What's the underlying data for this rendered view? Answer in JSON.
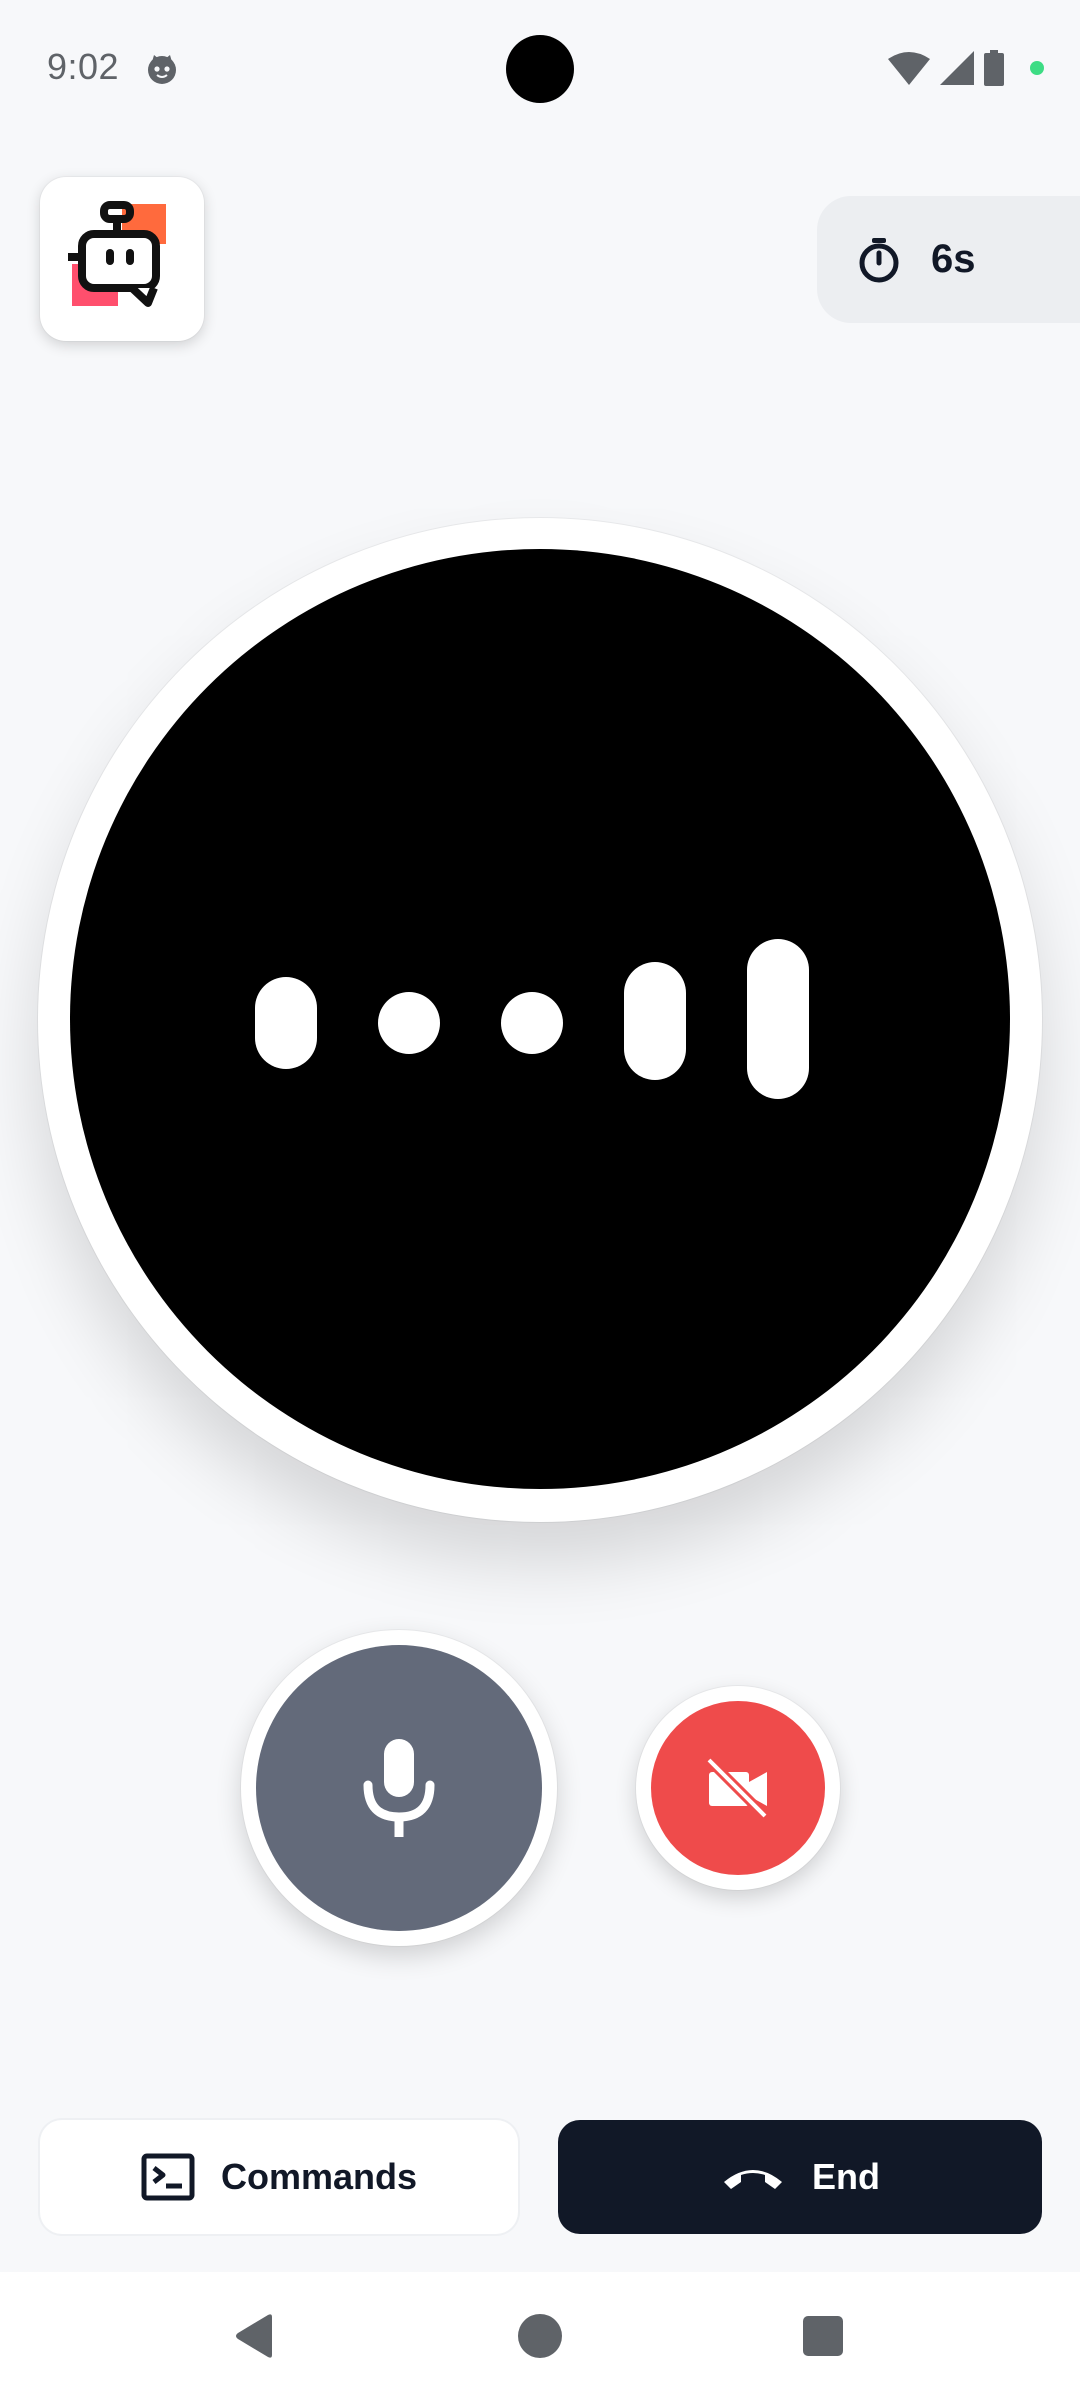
{
  "status_bar": {
    "time": "9:02",
    "app_icon": "cat-notification-icon",
    "icons": [
      "wifi-icon",
      "cellular-signal-icon",
      "battery-icon",
      "privacy-indicator-dot"
    ],
    "indicator_color": "#3ddc84"
  },
  "header": {
    "logo_icon": "robot-logo-icon",
    "timer": {
      "icon": "stopwatch-icon",
      "label": "6s"
    }
  },
  "audio_visualizer": {
    "icon": "audio-waveform",
    "bar_levels": [
      0.56,
      0.4,
      0.48,
      0.74,
      1.0
    ]
  },
  "controls": {
    "mic": {
      "icon": "microphone-icon",
      "state": "unmuted",
      "color": "#636a7a"
    },
    "video": {
      "icon": "video-off-icon",
      "state": "off",
      "color": "#ef4b4b"
    }
  },
  "actions": {
    "commands": {
      "label": "Commands",
      "icon": "terminal-icon"
    },
    "end": {
      "label": "End",
      "icon": "phone-hangup-icon",
      "color": "#111827"
    }
  },
  "system_nav": {
    "back": "back-triangle-icon",
    "home": "home-circle-icon",
    "recents": "recents-square-icon"
  }
}
